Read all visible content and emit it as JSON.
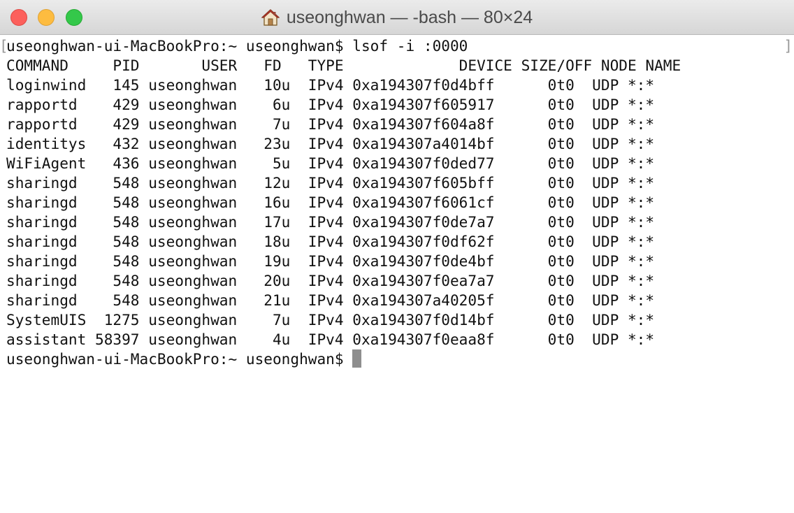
{
  "window": {
    "title": "useonghwan — -bash — 80×24",
    "icon": "home-icon"
  },
  "terminal": {
    "prompt_line": "useonghwan-ui-MacBookPro:~ useonghwan$ lsof -i :0000",
    "header": "COMMAND     PID       USER   FD   TYPE             DEVICE SIZE/OFF NODE NAME",
    "rows": [
      "loginwind   145 useonghwan   10u  IPv4 0xa194307f0d4bff      0t0  UDP *:*",
      "rapportd    429 useonghwan    6u  IPv4 0xa194307f605917      0t0  UDP *:*",
      "rapportd    429 useonghwan    7u  IPv4 0xa194307f604a8f      0t0  UDP *:*",
      "identitys   432 useonghwan   23u  IPv4 0xa194307a4014bf      0t0  UDP *:*",
      "WiFiAgent   436 useonghwan    5u  IPv4 0xa194307f0ded77      0t0  UDP *:*",
      "sharingd    548 useonghwan   12u  IPv4 0xa194307f605bff      0t0  UDP *:*",
      "sharingd    548 useonghwan   16u  IPv4 0xa194307f6061cf      0t0  UDP *:*",
      "sharingd    548 useonghwan   17u  IPv4 0xa194307f0de7a7      0t0  UDP *:*",
      "sharingd    548 useonghwan   18u  IPv4 0xa194307f0df62f      0t0  UDP *:*",
      "sharingd    548 useonghwan   19u  IPv4 0xa194307f0de4bf      0t0  UDP *:*",
      "sharingd    548 useonghwan   20u  IPv4 0xa194307f0ea7a7      0t0  UDP *:*",
      "sharingd    548 useonghwan   21u  IPv4 0xa194307a40205f      0t0  UDP *:*",
      "SystemUIS  1275 useonghwan    7u  IPv4 0xa194307f0d14bf      0t0  UDP *:*",
      "assistant 58397 useonghwan    4u  IPv4 0xa194307f0eaa8f      0t0  UDP *:*"
    ],
    "final_prompt": "useonghwan-ui-MacBookPro:~ useonghwan$"
  },
  "colors": {
    "close": "#fc605c",
    "minimize": "#fdbc40",
    "zoom": "#34c84a",
    "cursor": "#8e8e8e"
  }
}
